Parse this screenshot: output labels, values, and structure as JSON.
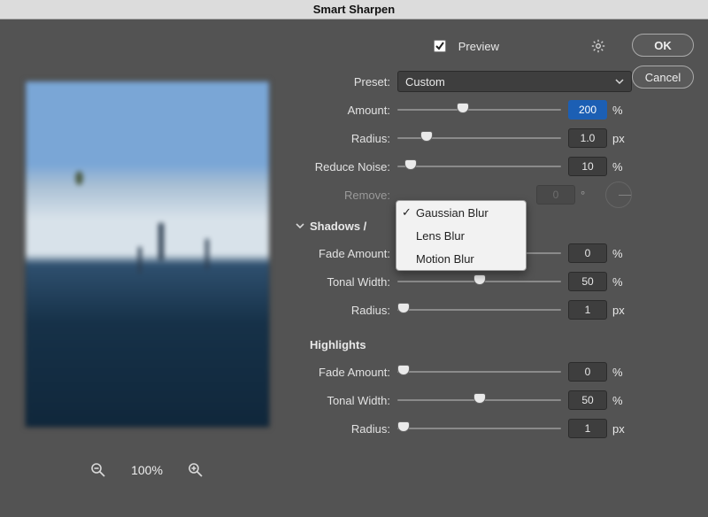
{
  "title": "Smart Sharpen",
  "buttons": {
    "ok": "OK",
    "cancel": "Cancel"
  },
  "preview_checkbox": {
    "label": "Preview",
    "checked": true
  },
  "preset": {
    "label": "Preset:",
    "value": "Custom"
  },
  "amount": {
    "label": "Amount:",
    "value": "200",
    "unit": "%",
    "slider_pct": 40
  },
  "radius": {
    "label": "Radius:",
    "value": "1.0",
    "unit": "px",
    "slider_pct": 18
  },
  "noise": {
    "label": "Reduce Noise:",
    "value": "10",
    "unit": "%",
    "slider_pct": 8
  },
  "remove": {
    "label": "Remove:",
    "options": [
      "Gaussian Blur",
      "Lens Blur",
      "Motion Blur"
    ],
    "selected": "Gaussian Blur",
    "angle": "0",
    "angle_unit": "°"
  },
  "shadows_section": "Shadows /",
  "highlights_section": "Highlights",
  "shadows": {
    "fade": {
      "label": "Fade Amount:",
      "value": "0",
      "unit": "%",
      "slider_pct": 4
    },
    "tonal": {
      "label": "Tonal Width:",
      "value": "50",
      "unit": "%",
      "slider_pct": 50
    },
    "radius": {
      "label": "Radius:",
      "value": "1",
      "unit": "px",
      "slider_pct": 4
    }
  },
  "highlights": {
    "fade": {
      "label": "Fade Amount:",
      "value": "0",
      "unit": "%",
      "slider_pct": 4
    },
    "tonal": {
      "label": "Tonal Width:",
      "value": "50",
      "unit": "%",
      "slider_pct": 50
    },
    "radius": {
      "label": "Radius:",
      "value": "1",
      "unit": "px",
      "slider_pct": 4
    }
  },
  "zoom": "100%"
}
